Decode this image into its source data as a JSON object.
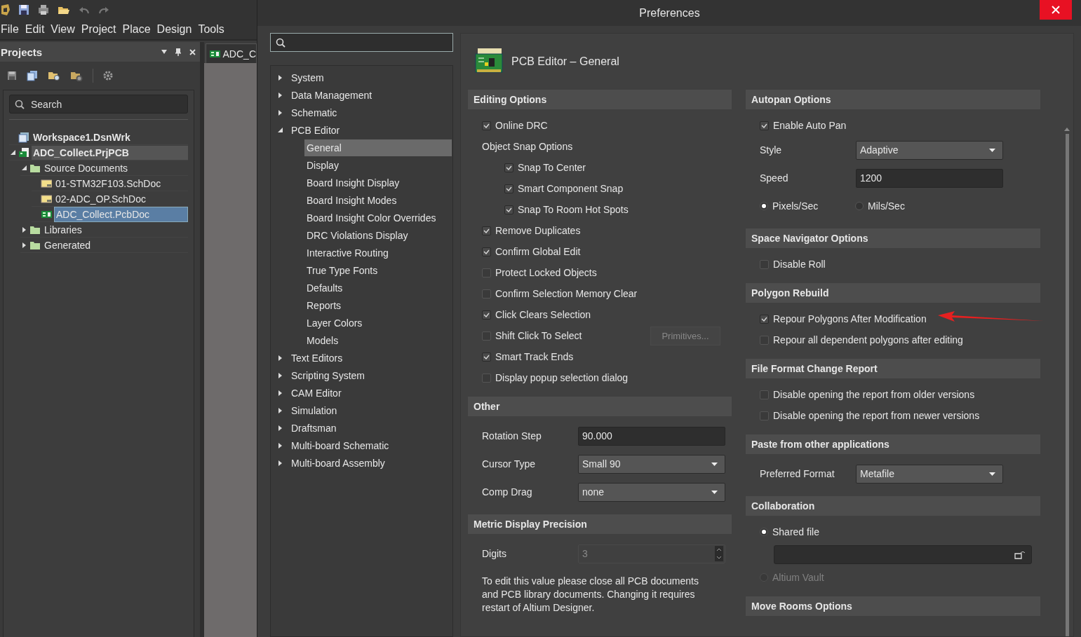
{
  "app": {
    "menu": [
      "File",
      "Edit",
      "View",
      "Project",
      "Place",
      "Design",
      "Tools"
    ],
    "projects_panel": {
      "title": "Projects",
      "search": {
        "placeholder": "Search"
      },
      "tree": [
        {
          "label": "Workspace1.DsnWrk",
          "kind": "workspace"
        },
        {
          "label": "ADC_Collect.PrjPCB",
          "kind": "project",
          "active": true,
          "expanded": true,
          "children": [
            {
              "label": "Source Documents",
              "kind": "folder",
              "expanded": true,
              "children": [
                {
                  "label": "01-STM32F103.SchDoc",
                  "kind": "schdoc",
                  "selected": false
                },
                {
                  "label": "02-ADC_OP.SchDoc",
                  "kind": "schdoc",
                  "selected": false
                },
                {
                  "label": "ADC_Collect.PcbDoc",
                  "kind": "pcbdoc",
                  "selected": true
                }
              ]
            },
            {
              "label": "Libraries",
              "kind": "folder",
              "expanded": false
            },
            {
              "label": "Generated",
              "kind": "folder",
              "expanded": false
            }
          ]
        }
      ]
    },
    "document_tab": {
      "label": "ADC_C"
    }
  },
  "dialog": {
    "title": "Preferences",
    "nav": [
      {
        "label": "System",
        "expanded": false
      },
      {
        "label": "Data Management",
        "expanded": false
      },
      {
        "label": "Schematic",
        "expanded": false
      },
      {
        "label": "PCB Editor",
        "expanded": true,
        "children": [
          {
            "label": "General",
            "selected": true
          },
          {
            "label": "Display",
            "selected": false
          },
          {
            "label": "Board Insight Display",
            "selected": false
          },
          {
            "label": "Board Insight Modes",
            "selected": false
          },
          {
            "label": "Board Insight Color Overrides",
            "selected": false
          },
          {
            "label": "DRC Violations Display",
            "selected": false
          },
          {
            "label": "Interactive Routing",
            "selected": false
          },
          {
            "label": "True Type Fonts",
            "selected": false
          },
          {
            "label": "Defaults",
            "selected": false
          },
          {
            "label": "Reports",
            "selected": false
          },
          {
            "label": "Layer Colors",
            "selected": false
          },
          {
            "label": "Models",
            "selected": false
          }
        ]
      },
      {
        "label": "Text Editors",
        "expanded": false
      },
      {
        "label": "Scripting System",
        "expanded": false
      },
      {
        "label": "CAM Editor",
        "expanded": false
      },
      {
        "label": "Simulation",
        "expanded": false
      },
      {
        "label": "Draftsman",
        "expanded": false
      },
      {
        "label": "Multi-board Schematic",
        "expanded": false
      },
      {
        "label": "Multi-board Assembly",
        "expanded": false
      }
    ],
    "page_title": "PCB Editor – General",
    "left_sections": [
      {
        "title": "Editing Options",
        "items": [
          {
            "kind": "checkbox",
            "label": "Online DRC",
            "checked": true
          },
          {
            "kind": "group",
            "label": "Object Snap Options",
            "children": [
              {
                "kind": "checkbox",
                "label": "Snap To Center",
                "checked": true
              },
              {
                "kind": "checkbox",
                "label": "Smart Component Snap",
                "checked": true
              },
              {
                "kind": "checkbox",
                "label": "Snap To Room Hot Spots",
                "checked": true
              }
            ]
          },
          {
            "kind": "checkbox",
            "label": "Remove Duplicates",
            "checked": true
          },
          {
            "kind": "checkbox",
            "label": "Confirm Global Edit",
            "checked": true
          },
          {
            "kind": "checkbox",
            "label": "Protect Locked Objects",
            "checked": false
          },
          {
            "kind": "checkbox",
            "label": "Confirm Selection Memory Clear",
            "checked": false
          },
          {
            "kind": "checkbox",
            "label": "Click Clears Selection",
            "checked": true
          },
          {
            "kind": "checkbox",
            "label": "Shift Click To Select",
            "checked": false,
            "button": {
              "label": "Primitives...",
              "disabled": true
            }
          },
          {
            "kind": "checkbox",
            "label": "Smart Track Ends",
            "checked": true
          },
          {
            "kind": "checkbox",
            "label": "Display popup selection dialog",
            "checked": false
          }
        ]
      },
      {
        "title": "Other",
        "items": [
          {
            "kind": "input",
            "label": "Rotation Step",
            "value": "90.000"
          },
          {
            "kind": "dropdown",
            "label": "Cursor Type",
            "value": "Small 90"
          },
          {
            "kind": "dropdown",
            "label": "Comp Drag",
            "value": "none"
          }
        ]
      },
      {
        "title": "Metric Display Precision",
        "items": [
          {
            "kind": "spinner",
            "label": "Digits",
            "value": "3",
            "disabled": true
          },
          {
            "kind": "note",
            "text": "To edit this value please close all PCB documents and PCB library documents. Changing it requires restart of Altium Designer."
          }
        ]
      }
    ],
    "right_sections": [
      {
        "title": "Autopan Options",
        "items": [
          {
            "kind": "checkbox",
            "label": "Enable Auto Pan",
            "checked": true
          },
          {
            "kind": "dropdown",
            "label": "Style",
            "value": "Adaptive"
          },
          {
            "kind": "input",
            "label": "Speed",
            "value": "1200"
          },
          {
            "kind": "radio-row",
            "options": [
              {
                "label": "Pixels/Sec",
                "selected": true
              },
              {
                "label": "Mils/Sec",
                "selected": false
              }
            ]
          }
        ]
      },
      {
        "title": "Space Navigator Options",
        "items": [
          {
            "kind": "checkbox",
            "label": "Disable Roll",
            "checked": false
          }
        ]
      },
      {
        "title": "Polygon Rebuild",
        "items": [
          {
            "kind": "checkbox",
            "label": "Repour Polygons After Modification",
            "checked": true,
            "annotated": true
          },
          {
            "kind": "checkbox",
            "label": "Repour all dependent polygons after editing",
            "checked": false
          }
        ]
      },
      {
        "title": "File Format Change Report",
        "items": [
          {
            "kind": "checkbox",
            "label": "Disable opening the report from older versions",
            "checked": false
          },
          {
            "kind": "checkbox",
            "label": "Disable opening the report from newer versions",
            "checked": false
          }
        ]
      },
      {
        "title": "Paste from other applications",
        "items": [
          {
            "kind": "dropdown",
            "label": "Preferred Format",
            "value": "Metafile"
          }
        ]
      },
      {
        "title": "Collaboration",
        "items": [
          {
            "kind": "radio",
            "label": "Shared file",
            "selected": true,
            "disabled": false
          },
          {
            "kind": "path"
          },
          {
            "kind": "radio",
            "label": "Altium Vault",
            "selected": false,
            "disabled": true
          }
        ]
      },
      {
        "title": "Move Rooms Options"
      }
    ]
  }
}
